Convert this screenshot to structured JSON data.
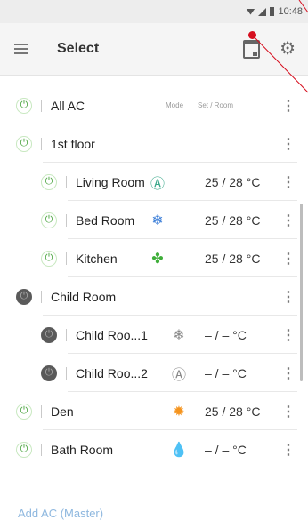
{
  "status_bar": {
    "time": "10:48"
  },
  "toolbar": {
    "title": "Select"
  },
  "columns": {
    "mode": "Mode",
    "set_room": "Set / Room"
  },
  "rows": [
    {
      "name": "All AC",
      "power": "on",
      "level": 0,
      "mode": "",
      "temp": "",
      "unit": ""
    },
    {
      "name": "1st floor",
      "power": "on",
      "level": 0,
      "mode": "",
      "temp": "",
      "unit": ""
    },
    {
      "name": "Living Room",
      "power": "on",
      "level": 1,
      "mode": "Ⓐ",
      "mode_color": "#3aa88a",
      "temp": "25 / 28",
      "unit": "°C"
    },
    {
      "name": "Bed Room",
      "power": "on",
      "level": 1,
      "mode": "❄",
      "mode_color": "#3b7ed8",
      "temp": "25 / 28",
      "unit": "°C"
    },
    {
      "name": "Kitchen",
      "power": "on",
      "level": 1,
      "mode": "✤",
      "mode_color": "#3fae3a",
      "temp": "25 / 28",
      "unit": "°C"
    },
    {
      "name": "Child Room",
      "power": "off",
      "level": 0,
      "mode": "",
      "temp": "",
      "unit": ""
    },
    {
      "name": "Child Roo...1",
      "power": "off",
      "level": 1,
      "mode": "❄",
      "mode_color": "#888888",
      "temp": "– / –",
      "unit": "°C"
    },
    {
      "name": "Child Roo...2",
      "power": "off",
      "level": 1,
      "mode": "Ⓐ",
      "mode_color": "#888888",
      "temp": "– / –",
      "unit": "°C"
    },
    {
      "name": "Den",
      "power": "on",
      "level": 0,
      "mode": "✹",
      "mode_color": "#f5941e",
      "temp": "25 / 28",
      "unit": "°C"
    },
    {
      "name": "Bath Room",
      "power": "on",
      "level": 0,
      "mode": "💧",
      "mode_color": "#3aa0d8",
      "temp": "– / –",
      "unit": "°C"
    }
  ],
  "footer": {
    "label": "Add AC (Master)"
  },
  "accent": "#d60f1f"
}
